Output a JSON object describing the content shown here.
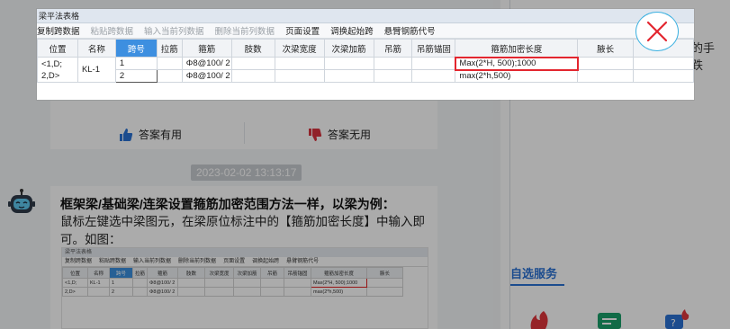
{
  "colors": {
    "accent": "#2a72d4",
    "active_header": "#3d8fe0",
    "highlight_box": "#e3262f",
    "overlay": "rgba(0,0,0,0.33)",
    "close_ring": "#3ab0e0"
  },
  "feedback": {
    "useful_label": "答案有用",
    "useless_label": "答案无用",
    "useful_icon": "thumbs-up-icon",
    "useless_icon": "thumbs-down-icon"
  },
  "timestamp": "2023-02-02 13:13:17",
  "answer": {
    "title": "框架梁/基础梁/连梁设置箍筋加密范围方法一样，以梁为例：",
    "body": "鼠标左键选中梁图元，在梁原位标注中的【箍筋加密长度】中输入即可。如图：",
    "thumbnail": {
      "title": "梁平法表格",
      "toolbar": [
        "复制跨数据",
        "粘贴跨数据",
        "输入当前列数据",
        "删除当前列数据",
        "页面设置",
        "调换起始跨",
        "悬臂钢筋代号"
      ],
      "headers": [
        "位置",
        "名称",
        "跨号",
        "拉筋",
        "箍筋",
        "肢数",
        "次梁宽度",
        "次梁加筋",
        "吊筋",
        "吊筋锚固",
        "箍筋加密长度",
        "腋长"
      ],
      "rows": [
        [
          "<1,D;",
          "KL-1",
          "1",
          "",
          "Φ8@100/ 2",
          "",
          "",
          "",
          "",
          "",
          "Max(2*H, 500);1000",
          ""
        ],
        [
          "2,D>",
          "",
          "2",
          "",
          "Φ8@100/ 2",
          "",
          "",
          "",
          "",
          "",
          "max(2*h,500)",
          ""
        ]
      ]
    }
  },
  "right_panel": {
    "snippet_line1": "的手",
    "snippet_line2": "跌",
    "section_title": "自选服务",
    "service_icons": [
      "fire-service-icon",
      "card-service-icon",
      "hot-question-icon"
    ]
  },
  "preview": {
    "window_title": "梁平法表格",
    "toolbar": [
      {
        "label": "复制跨数据",
        "enabled": true
      },
      {
        "label": "粘贴跨数据",
        "enabled": false
      },
      {
        "label": "输入当前列数据",
        "enabled": false
      },
      {
        "label": "删除当前列数据",
        "enabled": false
      },
      {
        "label": "页面设置",
        "enabled": true
      },
      {
        "label": "调换起始跨",
        "enabled": true
      },
      {
        "label": "悬臂钢筋代号",
        "enabled": true
      }
    ],
    "headers": [
      "位置",
      "名称",
      "跨号",
      "拉筋",
      "箍筋",
      "肢数",
      "次梁宽度",
      "次梁加筋",
      "吊筋",
      "吊筋锚固",
      "箍筋加密长度",
      "腋长"
    ],
    "active_header": "跨号",
    "position_value": "<1,D;\n2,D>",
    "name_value": "KL-1",
    "rows": [
      {
        "span": "1",
        "tie": "",
        "stirrup": "Φ8@100/ 2",
        "legs": "",
        "sec_width": "",
        "sec_add": "",
        "hanger": "",
        "hanger_anchor": "",
        "dense_length": "Max(2*H, 500);1000",
        "haunch": ""
      },
      {
        "span": "2",
        "tie": "",
        "stirrup": "Φ8@100/ 2",
        "legs": "",
        "sec_width": "",
        "sec_add": "",
        "hanger": "",
        "hanger_anchor": "",
        "dense_length": "max(2*h,500)",
        "haunch": ""
      }
    ],
    "close_icon": "close-icon"
  }
}
